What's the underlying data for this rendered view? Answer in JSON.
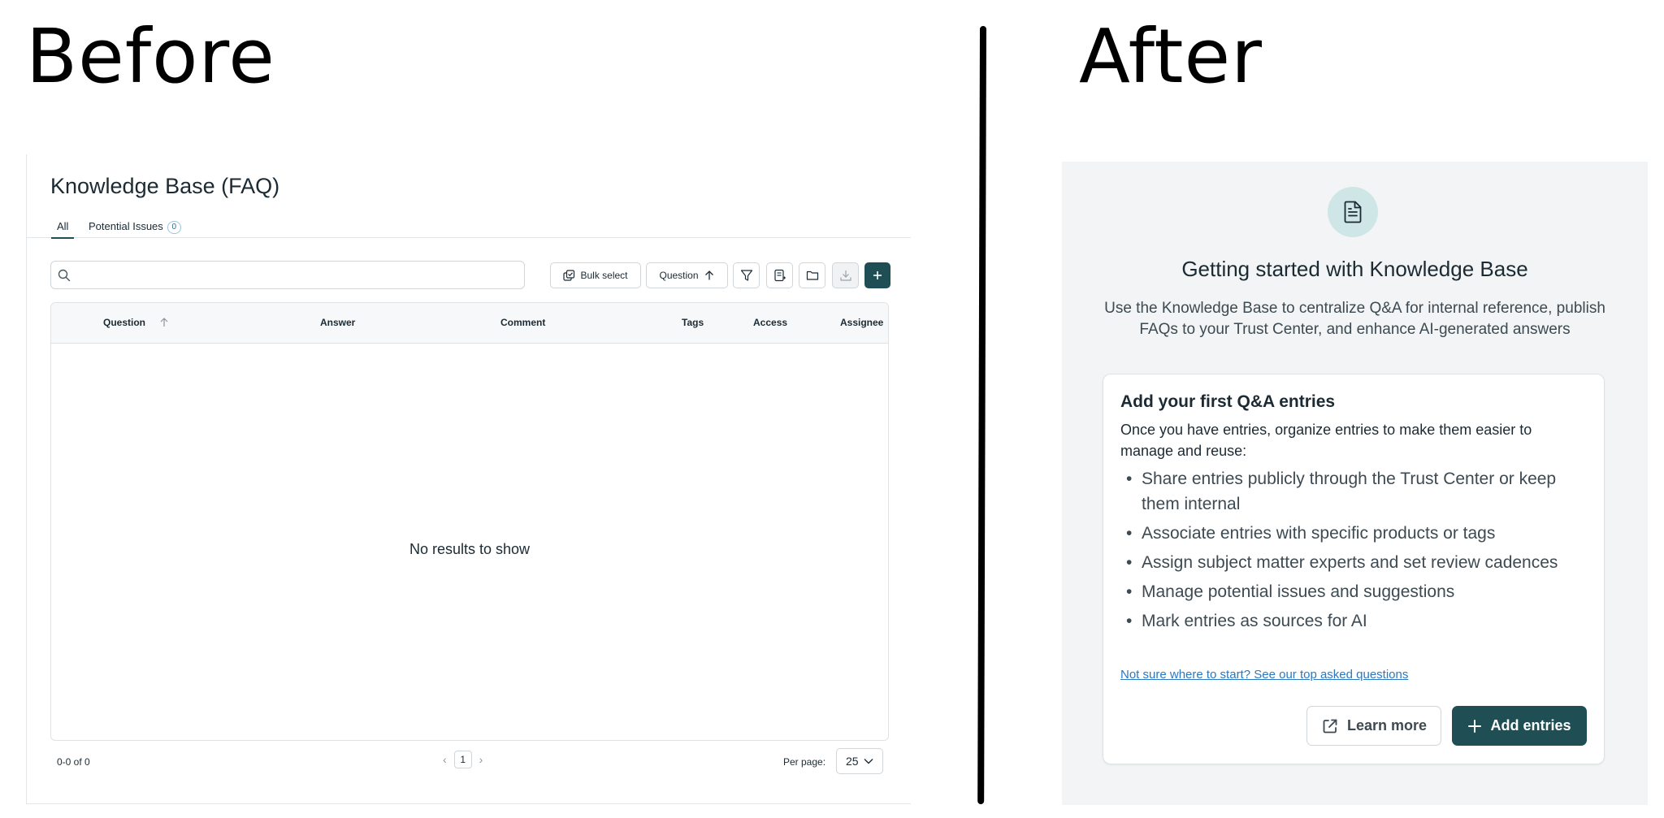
{
  "headings": {
    "before": "Before",
    "after": "After"
  },
  "before": {
    "title": "Knowledge Base (FAQ)",
    "tabs": [
      {
        "label": "All",
        "active": true
      },
      {
        "label": "Potential Issues",
        "count": "0"
      }
    ],
    "search": {
      "placeholder": ""
    },
    "toolbar": {
      "bulk_select": "Bulk select",
      "sort_label": "Question",
      "icons": [
        "filter-icon",
        "columns-icon",
        "folder-icon",
        "download-icon",
        "plus-icon"
      ]
    },
    "table": {
      "columns": [
        "Question",
        "Answer",
        "Comment",
        "Tags",
        "Access",
        "Assignee"
      ],
      "sort_column": "Question",
      "sort_direction": "ascending",
      "empty_message": "No results to show"
    },
    "footer": {
      "range": "0-0 of 0",
      "page": "1",
      "per_page_label": "Per page:",
      "per_page_value": "25"
    }
  },
  "after": {
    "icon": "document-icon",
    "title": "Getting started with Knowledge Base",
    "description": "Use the Knowledge Base to centralize Q&A for internal reference, publish FAQs to your Trust Center, and enhance AI-generated answers",
    "card": {
      "title": "Add your first Q&A entries",
      "intro": "Once you have entries, organize entries to make them easier to manage and reuse:",
      "items": [
        "Share entries publicly through the Trust Center or keep them internal",
        "Associate entries with specific products or tags",
        "Assign subject matter experts and set review cadences",
        "Manage potential issues and suggestions",
        "Mark entries as sources for AI"
      ],
      "help_link": "Not sure where to start? See our top asked questions",
      "learn_more": "Learn more",
      "add_entries": "Add entries"
    }
  },
  "colors": {
    "primary": "#1f4f55",
    "link": "#2b78c2",
    "icon_circle": "#cfe6e6",
    "after_background": "#f2f4f5"
  }
}
